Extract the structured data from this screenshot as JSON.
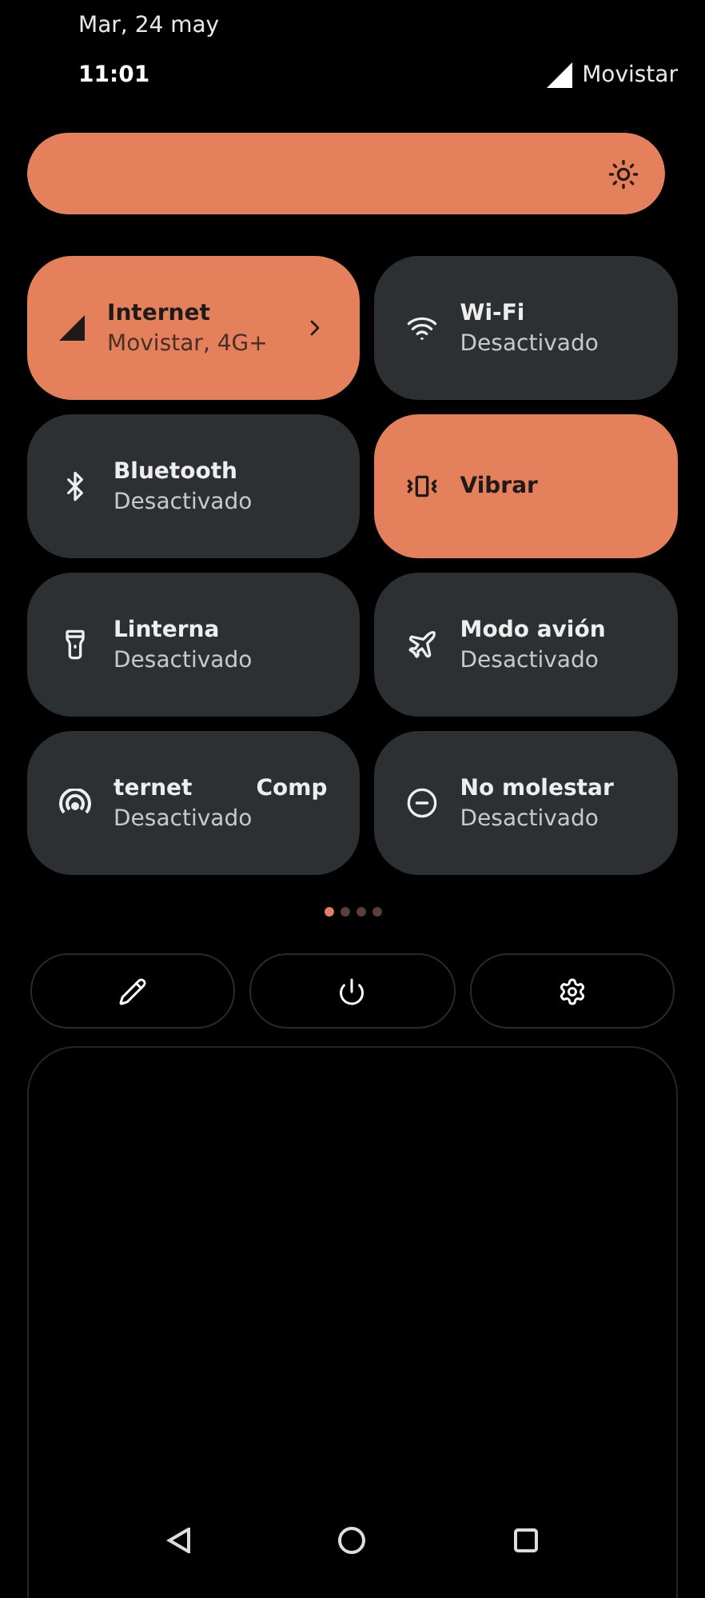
{
  "status": {
    "date": "Mar, 24 may",
    "time": "11:01",
    "carrier": "Movistar"
  },
  "brightness": {
    "level": 1.0
  },
  "tiles": [
    {
      "kind": "signal",
      "title": "Internet",
      "subtitle": "Movistar, 4G+",
      "on": true,
      "chevron": true
    },
    {
      "kind": "wifi",
      "title": "Wi-Fi",
      "subtitle": "Desactivado",
      "on": false
    },
    {
      "kind": "bluetooth",
      "title": "Bluetooth",
      "subtitle": "Desactivado",
      "on": false
    },
    {
      "kind": "vibrate",
      "title": "Vibrar",
      "on": true
    },
    {
      "kind": "flashlight",
      "title": "Linterna",
      "subtitle": "Desactivado",
      "on": false
    },
    {
      "kind": "airplane",
      "title": "Modo avión",
      "subtitle": "Desactivado",
      "on": false
    },
    {
      "kind": "hotspot",
      "title": "ternet",
      "title_2": "Comp",
      "subtitle": "Desactivado",
      "on": false
    },
    {
      "kind": "dnd",
      "title": "No molestar",
      "subtitle": "Desactivado",
      "on": false
    }
  ],
  "pages": [
    {
      "selected": true
    },
    {
      "selected": false
    },
    {
      "selected": false
    },
    {
      "selected": false
    }
  ],
  "actions": [
    {
      "kind": "edit"
    },
    {
      "kind": "power"
    },
    {
      "kind": "settings"
    }
  ],
  "nav": [
    {
      "kind": "back"
    },
    {
      "kind": "home"
    },
    {
      "kind": "recents"
    }
  ]
}
